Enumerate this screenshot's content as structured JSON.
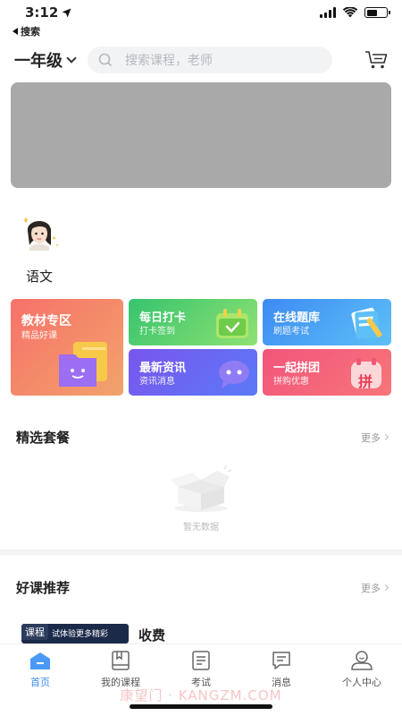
{
  "status_bar": {
    "time": "3:12",
    "battery_level": 0.55
  },
  "back_nav": {
    "label": "搜索"
  },
  "header": {
    "grade": "一年级",
    "search_placeholder": "搜索课程，老师"
  },
  "subjects": [
    {
      "label": "语文"
    }
  ],
  "feature_cards": [
    {
      "title": "教材专区",
      "subtitle": "精品好课"
    },
    {
      "title": "每日打卡",
      "subtitle": "打卡签到"
    },
    {
      "title": "在线题库",
      "subtitle": "刷题考试"
    },
    {
      "title": "最新资讯",
      "subtitle": "资讯消息"
    },
    {
      "title": "一起拼团",
      "subtitle": "拼购优惠",
      "badge": "拼"
    }
  ],
  "packages": {
    "title": "精选套餐",
    "more": "更多",
    "empty_text": "暂无数据"
  },
  "recommend": {
    "title": "好课推荐",
    "more": "更多",
    "course": {
      "tag": "课程",
      "thumb_text": "试体验更多精彩",
      "title": "收费"
    }
  },
  "tabbar": [
    {
      "label": "首页",
      "active": true
    },
    {
      "label": "我的课程"
    },
    {
      "label": "考试"
    },
    {
      "label": "消息"
    },
    {
      "label": "个人中心"
    }
  ],
  "watermark": "康望门 · KANGZM.COM",
  "colors": {
    "accent": "#3a8ef0",
    "banner": "#a9a9a9"
  }
}
